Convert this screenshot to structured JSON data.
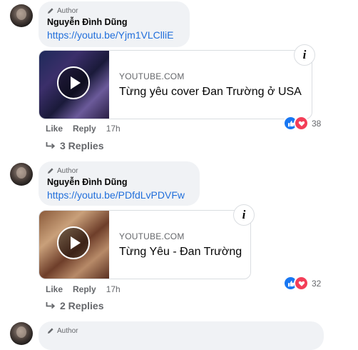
{
  "comments": [
    {
      "badge": "Author",
      "author": "Nguyễn Đình Dũng",
      "link": "https://youtu.be/Yjm1VLClliE",
      "card": {
        "domain": "YOUTUBE.COM",
        "title": "Từng yêu cover Đan Trường ở USA"
      },
      "actions": {
        "like": "Like",
        "reply": "Reply",
        "time": "17h"
      },
      "reaction_count": "38",
      "replies": "3 Replies"
    },
    {
      "badge": "Author",
      "author": "Nguyễn Đình Dũng",
      "link": "https://youtu.be/PDfdLvPDVFw",
      "card": {
        "domain": "YOUTUBE.COM",
        "title": "Từng Yêu - Đan Trường"
      },
      "actions": {
        "like": "Like",
        "reply": "Reply",
        "time": "17h"
      },
      "reaction_count": "32",
      "replies": "2 Replies"
    },
    {
      "badge": "Author"
    }
  ],
  "info_glyph": "i",
  "icons": [
    "pencil-icon",
    "play-icon",
    "info-icon",
    "like-reaction-icon",
    "love-reaction-icon",
    "reply-arrow-icon"
  ],
  "colors": {
    "link": "#216fdb",
    "like": "#1877f2",
    "love": "#f33e58",
    "bubble": "#f0f2f5",
    "meta": "#65676b"
  }
}
